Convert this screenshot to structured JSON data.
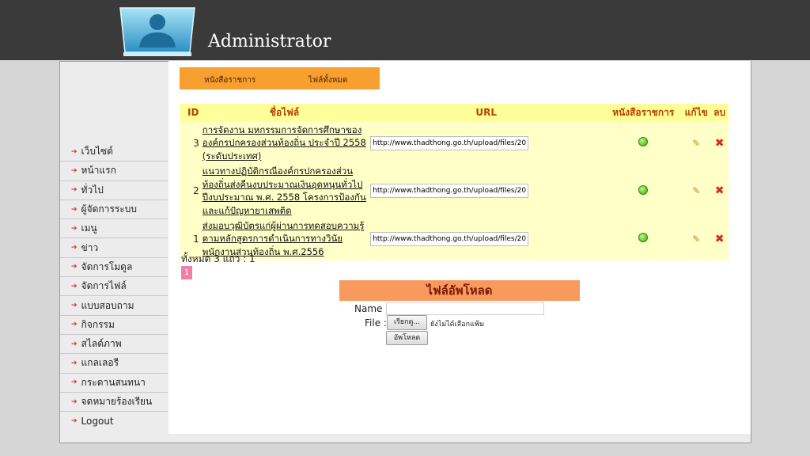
{
  "header": {
    "title": "Administrator",
    "logo_icon": "user-silhouette-icon"
  },
  "sidebar": {
    "items": [
      {
        "label": "เว็บไซต์"
      },
      {
        "label": "หน้าแรก"
      },
      {
        "label": "ทั่วไป"
      },
      {
        "label": "ผู้จัดการระบบ"
      },
      {
        "label": "เมนู"
      },
      {
        "label": "ข่าว"
      },
      {
        "label": "จัดการโมดูล"
      },
      {
        "label": "จัดการไฟล์"
      },
      {
        "label": "แบบสอบถาม"
      },
      {
        "label": "กิจกรรม"
      },
      {
        "label": "สไลด์ภาพ"
      },
      {
        "label": "แกลเลอรี"
      },
      {
        "label": "กระดานสนทนา"
      },
      {
        "label": "จดหมายร้องเรียน"
      },
      {
        "label": "Logout"
      }
    ]
  },
  "tabs": [
    {
      "label": "หนังสือราชการ"
    },
    {
      "label": "ไฟล์ทั้งหมด"
    }
  ],
  "table": {
    "headers": {
      "id": "ID",
      "name": "ชื่อไฟล์",
      "url": "URL",
      "official": "หนังสือราชการ",
      "edit": "แก้ไข",
      "delete": "ลบ"
    },
    "rows": [
      {
        "id": "3",
        "name": "การจัดงาน มหกรรมการจัดการศึกษาขององค์กรปกครองส่วนท้องถิ่น ประจำปี 2558 (ระดับประเทศ)",
        "url": "http://www.thadthong.go.th/upload/files/201",
        "official": true
      },
      {
        "id": "2",
        "name": "แนวทางปฏิบัติกรณีองค์กรปกครองส่วนท้องถิ่นส่งคืนงบประมาณเงินอุดหนุนทั่วไป ปีงบประมาณ พ.ศ. 2558 โครงการป้องกันและแก้ปัญหายาเสพติด",
        "url": "http://www.thadthong.go.th/upload/files/201",
        "official": true
      },
      {
        "id": "1",
        "name": "ส่งมอบวุฒิบัตรแก่ผู้ผ่านการทดสอบความรู้ตามหลักสูตรการดำเนินการทางวินัย พนักงานส่วนท้องถิ่น พ.ศ.2556",
        "url": "http://www.thadthong.go.th/upload/files/201",
        "official": true
      }
    ]
  },
  "summary": "ทั้งหมด 3 แถว : 1",
  "pagination": {
    "current": "1"
  },
  "upload": {
    "heading": "ไฟล์อัพโหลด",
    "name_label": "Name :",
    "file_label": "File :",
    "browse_label": "เรียกดู...",
    "no_file_text": "ยังไม่ได้เลือกแฟ้ม",
    "submit_label": "อัพโหลด"
  },
  "colors": {
    "topbar": "#3a3a3a",
    "tab_bar": "#f7a030",
    "table_bg": "#ffffc8",
    "upload_header": "#f89a5e",
    "page_active": "#f37fa4"
  }
}
